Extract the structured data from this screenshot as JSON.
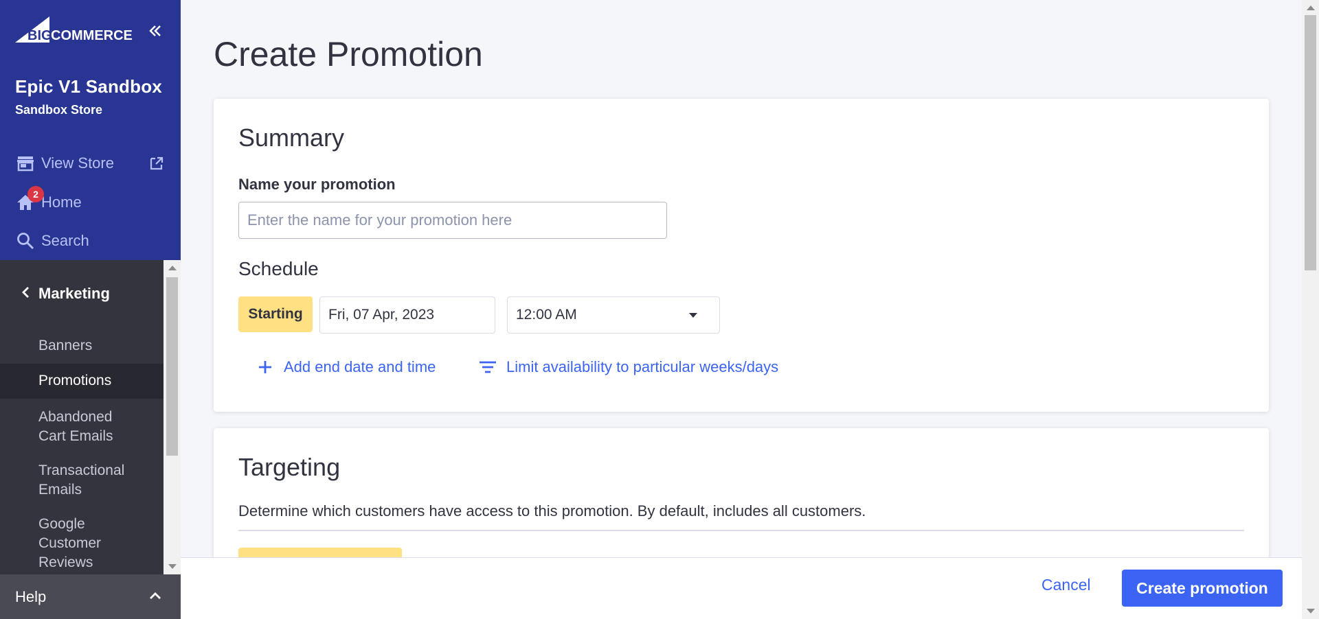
{
  "brand": {
    "logo_text": "BIGCOMMERCE",
    "store_name": "Epic V1 Sandbox",
    "store_type": "Sandbox Store"
  },
  "nav": {
    "view_store": "View Store",
    "home": "Home",
    "home_badge": "2",
    "search": "Search"
  },
  "section": {
    "title": "Marketing",
    "items": [
      {
        "label": "Banners"
      },
      {
        "label": "Promotions",
        "active": true
      },
      {
        "label": "Abandoned Cart Emails"
      },
      {
        "label": "Transactional Emails"
      },
      {
        "label": "Google Customer Reviews"
      }
    ]
  },
  "help": {
    "label": "Help"
  },
  "page": {
    "title": "Create Promotion"
  },
  "summary": {
    "heading": "Summary",
    "name_label": "Name your promotion",
    "name_value": "",
    "name_placeholder": "Enter the name for your promotion here",
    "schedule_heading": "Schedule",
    "starting_label": "Starting",
    "start_date": "Fri, 07 Apr, 2023",
    "start_time": "12:00 AM",
    "add_end_label": "Add end date and time",
    "limit_label": "Limit availability to particular weeks/days"
  },
  "targeting": {
    "heading": "Targeting",
    "description": "Determine which customers have access to this promotion. By default, includes all customers."
  },
  "footer": {
    "cancel_label": "Cancel",
    "create_label": "Create promotion"
  },
  "colors": {
    "sidebar_top": "#283593",
    "sidebar_bottom": "#34343f",
    "primary": "#3c64f4",
    "highlight": "#ffe082",
    "badge": "#db3643"
  }
}
